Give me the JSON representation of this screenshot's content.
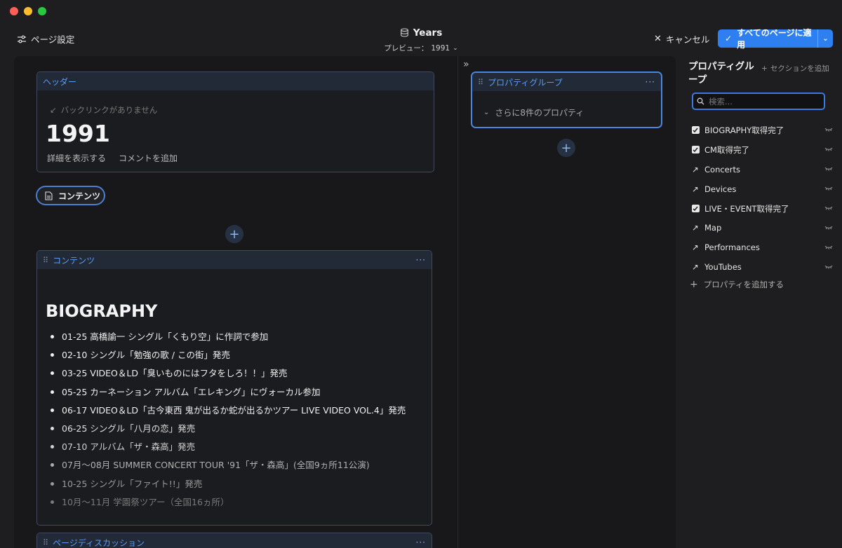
{
  "toolbar": {
    "page_settings": "ページ設定",
    "title": "Years",
    "preview_label": "プレビュー：",
    "preview_value": "1991",
    "cancel": "キャンセル",
    "apply": "すべてのページに適用"
  },
  "header_card": {
    "label": "ヘッダー",
    "backlink": "バックリンクがありません",
    "page_title": "1991",
    "show_details": "詳細を表示する",
    "add_comment": "コメントを追加"
  },
  "content_tab": {
    "label": "コンテンツ"
  },
  "contents_card": {
    "label": "コンテンツ",
    "heading": "BIOGRAPHY",
    "items": [
      {
        "text": "01-25 高橋諭一 シングル「くもり空」に作詞で参加",
        "color": "#f0f0f0"
      },
      {
        "text": "02-10 シングル「勉強の歌 / この街」発売",
        "color": "#f0f0f0"
      },
      {
        "text": "03-25 VIDEO＆LD「臭いものにはフタをしろ！！」発売",
        "color": "#f0f0f0"
      },
      {
        "text": "05-25 カーネーション アルバム「エレキング」にヴォーカル参加",
        "color": "#f0f0f0"
      },
      {
        "text": "06-17 VIDEO＆LD「古今東西 鬼が出るか蛇が出るかツアー LIVE VIDEO VOL.4」発売",
        "color": "#f0f0f0"
      },
      {
        "text": "06-25 シングル「八月の恋」発売",
        "color": "#e0e0e0"
      },
      {
        "text": "07-10 アルバム「ザ・森高」発売",
        "color": "#d0d0d0"
      },
      {
        "text": "07月～08月 SUMMER CONCERT TOUR '91「ザ・森高」(全国9ヵ所11公演)",
        "color": "#b0b0b0"
      },
      {
        "text": "10-25 シングル「ファイト!!」発売",
        "color": "#9a9a9a"
      },
      {
        "text": "10月～11月 学園祭ツアー（全国16ヵ所）",
        "color": "#7a7a7a"
      }
    ]
  },
  "discussion_card": {
    "label": "ページディスカッション"
  },
  "property_group": {
    "label": "プロパティグループ",
    "more": "さらに8件のプロパティ"
  },
  "sidebar": {
    "title": "プロパティグループ",
    "add_section": "セクションを追加",
    "search_placeholder": "検索...",
    "properties": [
      {
        "name": "BIOGRAPHY取得完了",
        "icon": "checkbox-icon"
      },
      {
        "name": "CM取得完了",
        "icon": "checkbox-icon"
      },
      {
        "name": "Concerts",
        "icon": "relation-arrow-icon"
      },
      {
        "name": "Devices",
        "icon": "relation-arrow-icon"
      },
      {
        "name": "LIVE・EVENT取得完了",
        "icon": "checkbox-icon"
      },
      {
        "name": "Map",
        "icon": "relation-arrow-icon"
      },
      {
        "name": "Performances",
        "icon": "relation-arrow-icon"
      },
      {
        "name": "YouTubes",
        "icon": "relation-arrow-icon"
      }
    ],
    "add_property": "プロパティを追加する"
  },
  "colors": {
    "accent": "#2e7ff0",
    "link": "#5b9cf5"
  }
}
